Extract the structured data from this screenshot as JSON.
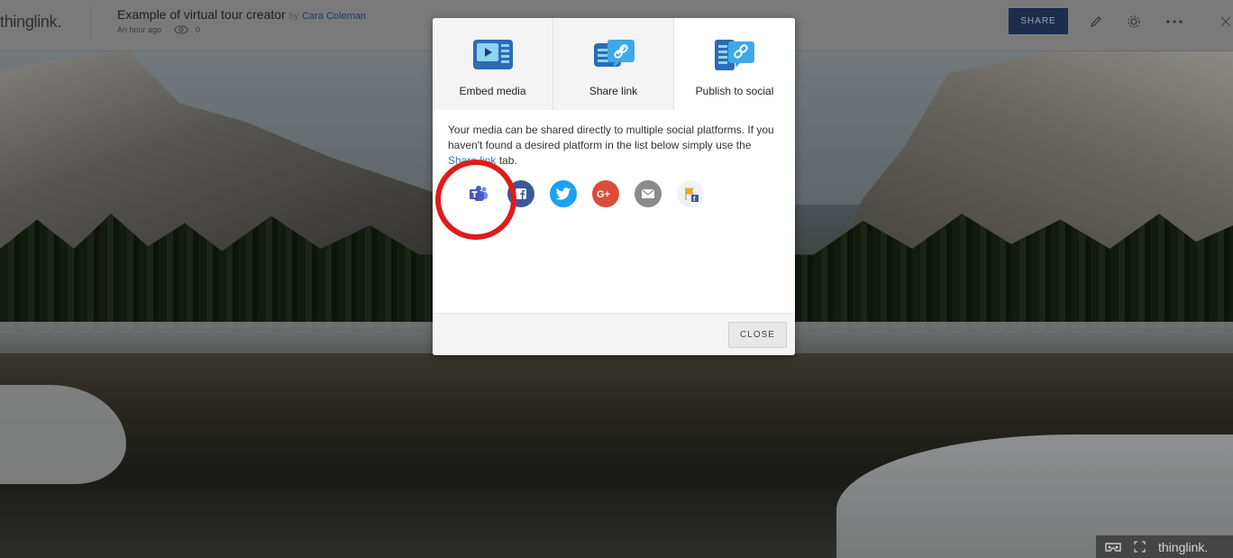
{
  "topbar": {
    "logo": "thinglink.",
    "title": "Example of virtual tour creator",
    "by": "by",
    "author": "Cara Coleman",
    "time": "An hour ago",
    "views": "0",
    "share_label": "SHARE"
  },
  "modal": {
    "tabs": [
      {
        "label": "Embed media"
      },
      {
        "label": "Share link"
      },
      {
        "label": "Publish to social"
      }
    ],
    "text_1": "Your media can be shared directly to multiple social platforms. If you haven't found a desired platform in the list below simply use the ",
    "link": "Share link",
    "text_2": " tab.",
    "close_label": "CLOSE"
  },
  "social": [
    {
      "icon": "microsoft-teams-icon",
      "color": "#ffffff"
    },
    {
      "icon": "facebook-icon",
      "color": "#3b5998"
    },
    {
      "icon": "twitter-icon",
      "color": "#1da1f2"
    },
    {
      "icon": "google-plus-icon",
      "color": "#dd4b39"
    },
    {
      "icon": "email-icon",
      "color": "#8a8a8a"
    },
    {
      "icon": "facebook-page-icon",
      "color": "#f2f2f2"
    }
  ],
  "bottom": {
    "logo": "thinglink."
  },
  "colors": {
    "accent": "#2a7ab8",
    "share_button": "#1c2d4d",
    "annotation": "#e11b1b"
  }
}
